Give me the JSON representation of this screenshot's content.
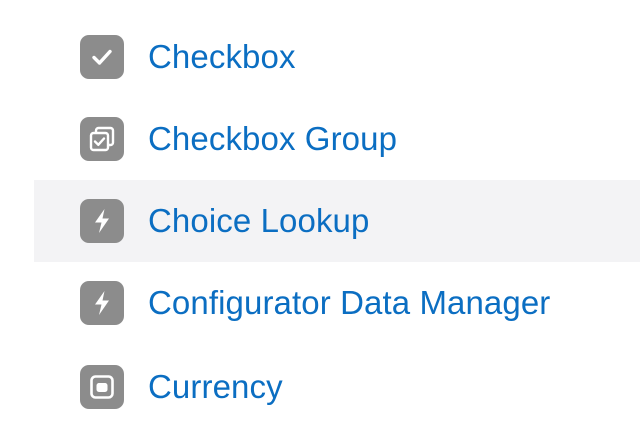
{
  "colors": {
    "link": "#0b6ec2",
    "icon_bg": "#8c8c8c",
    "hover_bg": "#f3f3f5"
  },
  "items": [
    {
      "label": "Checkbox",
      "icon": "checkbox-icon"
    },
    {
      "label": "Checkbox Group",
      "icon": "checkbox-group-icon"
    },
    {
      "label": "Choice Lookup",
      "icon": "lightning-icon"
    },
    {
      "label": "Configurator Data Manager",
      "icon": "lightning-icon"
    },
    {
      "label": "Currency",
      "icon": "currency-icon"
    }
  ]
}
